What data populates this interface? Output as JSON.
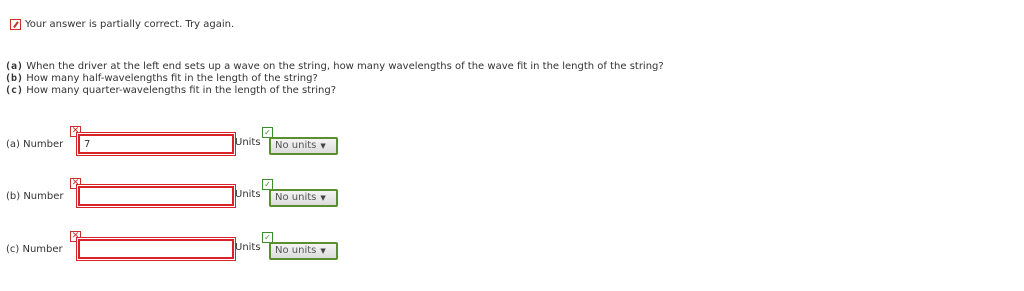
{
  "status": {
    "text": "Your answer is partially correct.  Try again.",
    "icon": "pencil-partial-icon"
  },
  "questions": [
    {
      "label": "(a)",
      "text": "When the driver at the left end sets up a wave on the string, how many wavelengths of the wave fit in the length of the string?"
    },
    {
      "label": "(b)",
      "text": "How many half-wavelengths fit in the length of the string?"
    },
    {
      "label": "(c)",
      "text": "How many quarter-wavelengths fit in the length of the string?"
    }
  ],
  "answers": [
    {
      "label": "(a) Number",
      "value": "7",
      "units_label": "Units",
      "units_value": "No units",
      "number_status": "incorrect",
      "units_status": "correct"
    },
    {
      "label": "(b) Number",
      "value": "",
      "units_label": "Units",
      "units_value": "No units",
      "number_status": "incorrect",
      "units_status": "correct"
    },
    {
      "label": "(c) Number",
      "value": "",
      "units_label": "Units",
      "units_value": "No units",
      "number_status": "incorrect",
      "units_status": "correct"
    }
  ],
  "colors": {
    "incorrect": "#d8232a",
    "correct": "#5a8f2f"
  }
}
